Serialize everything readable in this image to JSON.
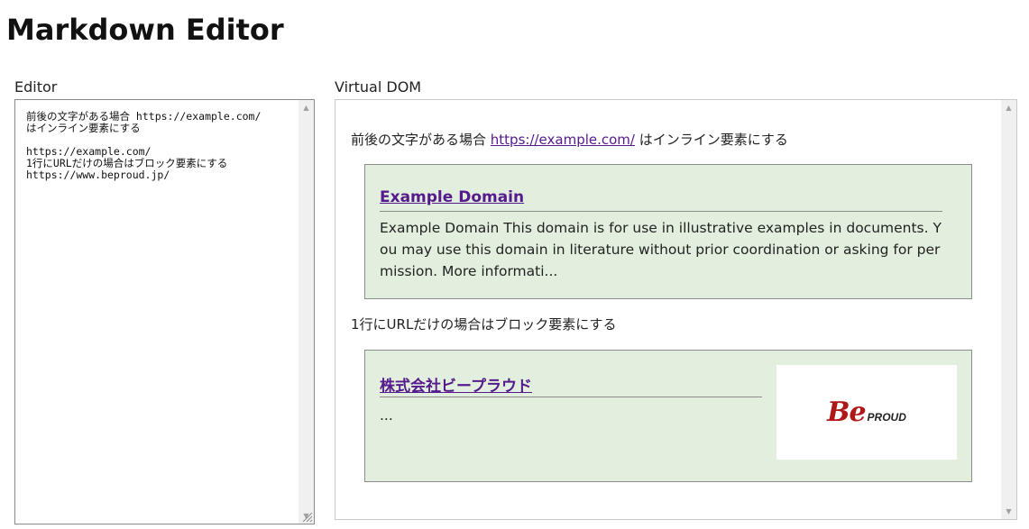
{
  "page": {
    "title": "Markdown Editor"
  },
  "editor": {
    "label": "Editor",
    "content": "前後の文字がある場合 https://example.com/\nはインライン要素にする\n\nhttps://example.com/\n1行にURLだけの場合はブロック要素にする\nhttps://www.beproud.jp/"
  },
  "virtual_dom": {
    "label": "Virtual DOM",
    "paragraph1": {
      "before": "前後の文字がある場合 ",
      "link": "https://example.com/",
      "after": " はインライン要素にする"
    },
    "card1": {
      "title": "Example Domain",
      "description": "Example Domain This domain is for use in illustrative examples in documents. You may use this domain in literature without prior coordination or asking for permission. More informati..."
    },
    "paragraph2": "1行にURLだけの場合はブロック要素にする",
    "card2": {
      "title": "株式会社ビープラウド",
      "description": "...",
      "thumbnail": {
        "logo_mark": "Be",
        "logo_text": "PROUD",
        "icon": "beproud-logo-icon"
      }
    }
  },
  "colors": {
    "card_background": "#e2efdf",
    "link_visited": "#551a8b",
    "logo_red": "#b01818"
  }
}
